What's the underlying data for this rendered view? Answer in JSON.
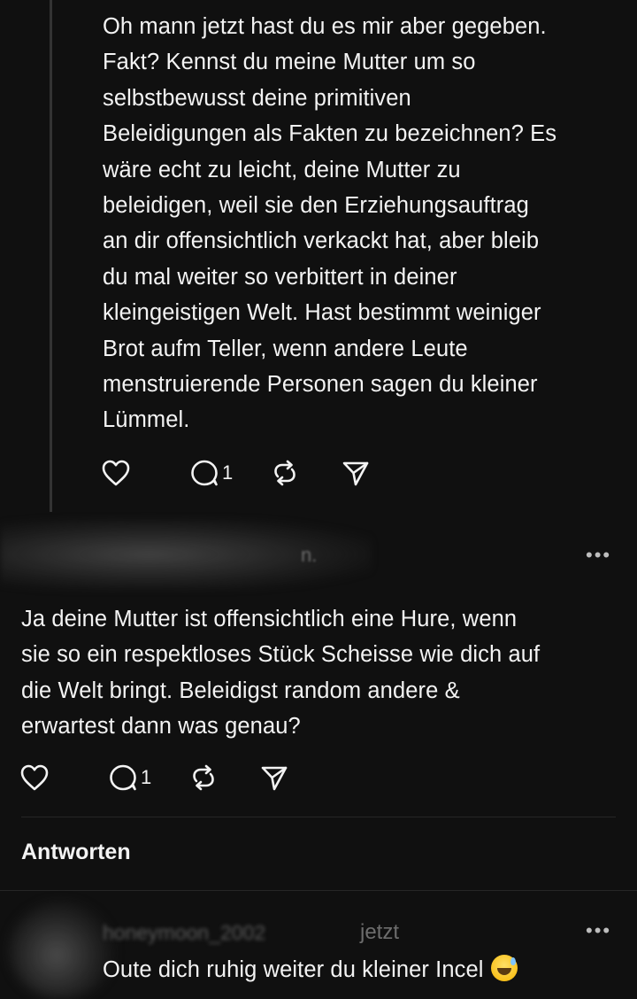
{
  "posts": [
    {
      "text": "Oh mann jetzt hast du es mir aber gegeben.\nFakt? Kennst du meine Mutter um so\nselbstbewusst deine primitiven\nBeleidigungen als Fakten zu bezeichnen? Es\nwäre echt zu leicht, deine Mutter zu\nbeleidigen, weil sie den Erziehungsauftrag\nan dir offensichtlich verkackt hat, aber bleib\ndu mal weiter so verbittert in deiner\nkleingeistigen Welt. Hast bestimmt weiniger\nBrot aufm Teller, wenn andere Leute\nmenstruierende Personen sagen du kleiner\nLümmel.",
      "reply_count": "1",
      "icons": [
        "heart-icon",
        "comment-icon",
        "repost-icon",
        "share-icon"
      ]
    },
    {
      "author_fragment": "n.",
      "more_label": "•••",
      "text": "Ja deine Mutter ist offensichtlich eine Hure, wenn\nsie so ein respektloses Stück Scheisse wie dich auf\ndie Welt bringt. Beleidigst random andere &\nerwartest dann was genau?",
      "reply_count": "1",
      "icons": [
        "heart-icon",
        "comment-icon",
        "repost-icon",
        "share-icon"
      ]
    }
  ],
  "replies_section": {
    "title": "Antworten"
  },
  "reply": {
    "author": "honeymoon_2002",
    "time": "jetzt",
    "more_label": "•••",
    "text": "Oute dich ruhig weiter du kleiner Incel",
    "emoji": "grinning-sweat-emoji"
  }
}
